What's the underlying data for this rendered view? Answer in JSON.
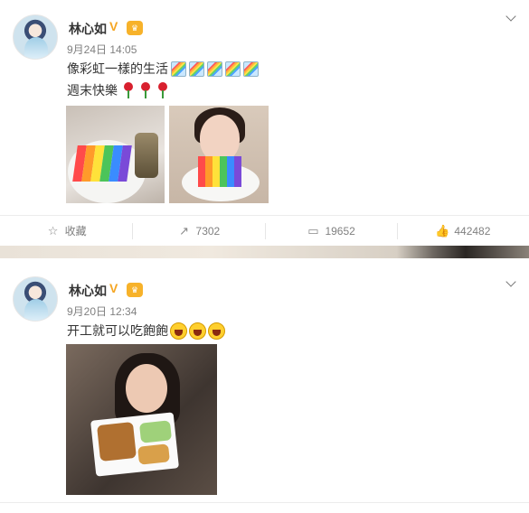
{
  "posts": [
    {
      "author": "林心如",
      "verified_mark": "V",
      "vip_badge": "♛",
      "time": "9月24日 14:05",
      "text_line1": "像彩虹一樣的生活",
      "text_line2": "週末快樂",
      "emoji_line1": [
        "rainbow-emoji",
        "rainbow-emoji",
        "rainbow-emoji",
        "rainbow-emoji",
        "rainbow-emoji"
      ],
      "emoji_line2": [
        "rose-emoji",
        "rose-emoji",
        "rose-emoji"
      ],
      "actions": {
        "favorite_label": "收藏",
        "repost_count": "7302",
        "comment_count": "19652",
        "like_count": "442482"
      }
    },
    {
      "author": "林心如",
      "verified_mark": "V",
      "vip_badge": "♛",
      "time": "9月20日 12:34",
      "text": "开工就可以吃飽飽",
      "emoji": [
        "laughing-emoji",
        "laughing-emoji",
        "laughing-emoji"
      ]
    }
  ],
  "colors": {
    "badge_orange": "#f5a623",
    "meta_gray": "#808080",
    "cake_bands": [
      "#ff4a4a",
      "#ff9a2a",
      "#ffe23a",
      "#4cc45a",
      "#3a8cff",
      "#7a4ad8"
    ]
  }
}
